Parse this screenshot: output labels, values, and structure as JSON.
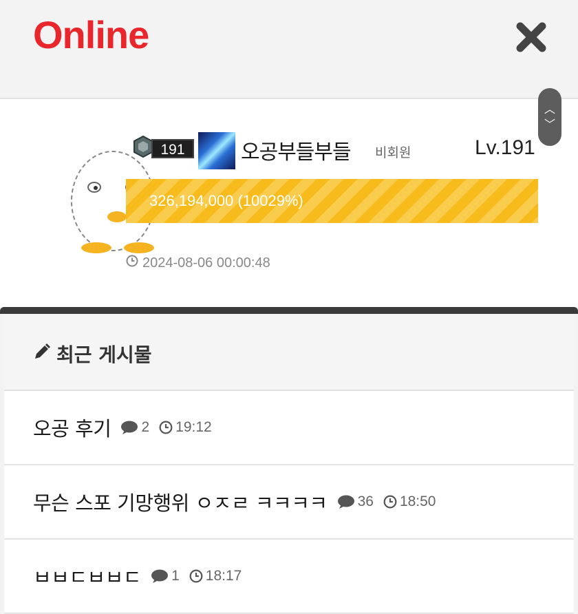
{
  "header": {
    "title": "Online",
    "close_icon": "close-icon"
  },
  "profile": {
    "rank_badge": "191",
    "username": "오공부들부들",
    "member_type": "비회원",
    "level": "Lv.191",
    "xp_text": "326,194,000 (10029%)",
    "xp_fill_percent": 100,
    "last_seen": "2024-08-06 00:00:48"
  },
  "recent": {
    "title": "최근 게시물",
    "posts": [
      {
        "title": "오공 후기",
        "comments": "2",
        "time": "19:12"
      },
      {
        "title": "무슨 스포 기망행위 ㅇㅈㄹ ㅋㅋㅋㅋ",
        "comments": "36",
        "time": "18:50"
      },
      {
        "title": "ㅂㅂㄷㅂㅂㄷ",
        "comments": "1",
        "time": "18:17"
      }
    ]
  },
  "colors": {
    "brand": "#e8262c",
    "xp_bar": "#f7bb1c",
    "scroll_btn": "#5d5d5d"
  }
}
